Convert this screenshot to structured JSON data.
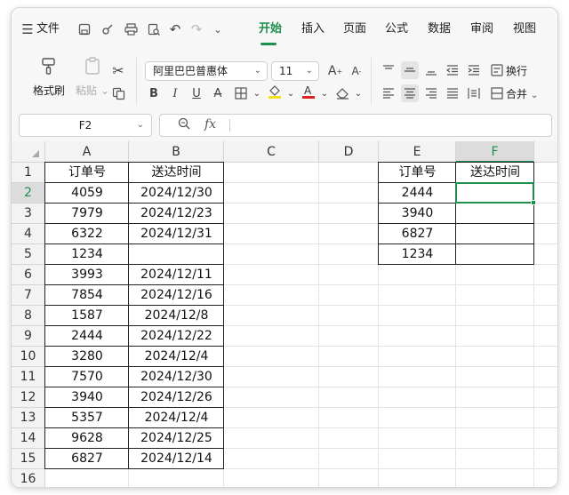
{
  "menubar": {
    "file_label": "文件",
    "tabs": [
      "开始",
      "插入",
      "页面",
      "公式",
      "数据",
      "审阅",
      "视图"
    ]
  },
  "ribbon": {
    "format_painter": "格式刷",
    "paste": "粘贴",
    "font_name": "阿里巴巴普惠体",
    "font_size": "11",
    "wrap": "换行",
    "merge": "合并"
  },
  "formula_bar": {
    "name_box": "F2",
    "fx": "fx",
    "content": ""
  },
  "grid": {
    "columns": [
      "A",
      "B",
      "C",
      "D",
      "E",
      "F"
    ],
    "rows": [
      "1",
      "2",
      "3",
      "4",
      "5",
      "6",
      "7",
      "8",
      "9",
      "10",
      "11",
      "12",
      "13",
      "14",
      "15",
      "16"
    ],
    "selected_column": "F",
    "selected_row": "2",
    "table1": {
      "header": [
        "订单号",
        "送达时间"
      ],
      "rows": [
        [
          "4059",
          "2024/12/30"
        ],
        [
          "7979",
          "2024/12/23"
        ],
        [
          "6322",
          "2024/12/31"
        ],
        [
          "1234",
          ""
        ],
        [
          "3993",
          "2024/12/11"
        ],
        [
          "7854",
          "2024/12/16"
        ],
        [
          "1587",
          "2024/12/8"
        ],
        [
          "2444",
          "2024/12/22"
        ],
        [
          "3280",
          "2024/12/4"
        ],
        [
          "7570",
          "2024/12/30"
        ],
        [
          "3940",
          "2024/12/26"
        ],
        [
          "5357",
          "2024/12/4"
        ],
        [
          "9628",
          "2024/12/25"
        ],
        [
          "6827",
          "2024/12/14"
        ]
      ]
    },
    "table2": {
      "header": [
        "订单号",
        "送达时间"
      ],
      "rows": [
        [
          "2444",
          ""
        ],
        [
          "3940",
          ""
        ],
        [
          "6827",
          ""
        ],
        [
          "1234",
          ""
        ]
      ]
    }
  },
  "colors": {
    "accent": "#1e8f4e",
    "font_color_bar": "#e02020",
    "fill_color_bar": "#f5e11b"
  }
}
